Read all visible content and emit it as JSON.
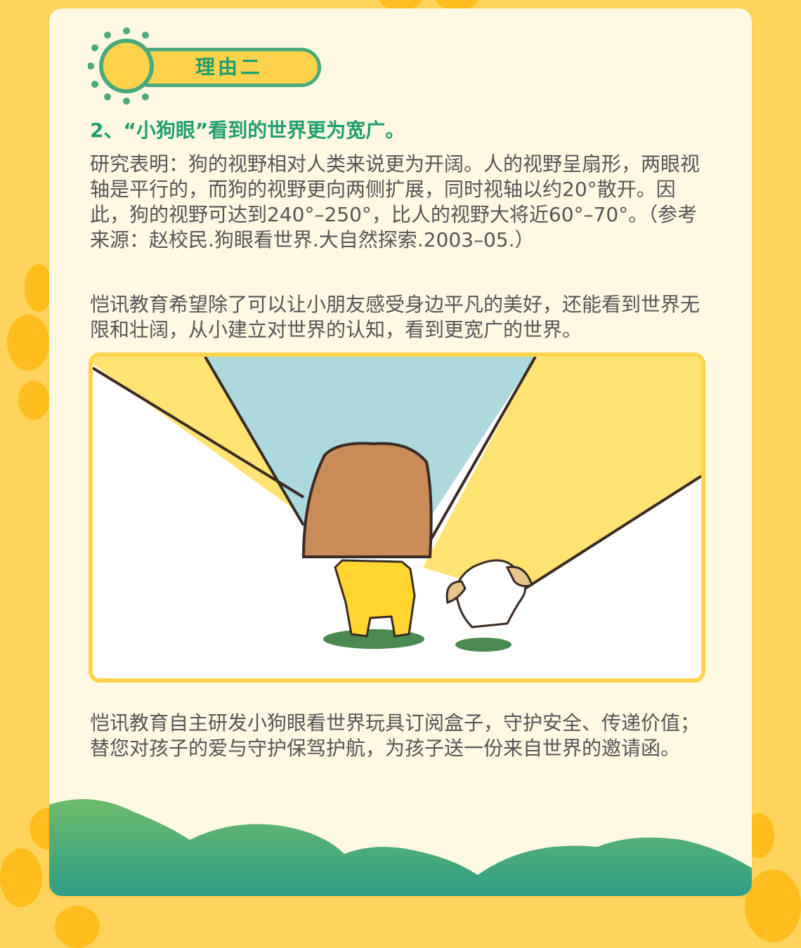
{
  "badge": {
    "label": "理由二"
  },
  "section": {
    "heading": "2、“小狗眼”看到的世界更为宽广。",
    "paragraph1": "研究表明：狗的视野相对人类来说更为开阔。人的视野呈扇形，两眼视轴是平行的，而狗的视野更向两侧扩展，同时视轴以约20°散开。因此，狗的视野可达到240°–250°，比人的视野大将近60°–70°。（参考来源：赵校民.狗眼看世界.大自然探索.2003–05.）",
    "paragraph2": "恺讯教育希望除了可以让小朋友感受身边平凡的美好，还能看到世界无限和壮阔，从小建立对世界的认知，看到更宽广的世界。",
    "paragraph3_line1": "恺讯教育自主研发小狗眼看世界玩具订阅盒子，守护安全、传递价值；",
    "paragraph3_line2": "替您对孩子的爱与守护保驾护航，为孩子送一份来自世界的邀请函。"
  },
  "colors": {
    "page_background": "#ffd45c",
    "card_background": "#fff9e3",
    "accent_green": "#1f9e6e",
    "accent_yellow": "#ffd24c",
    "paw": "#ffbe1e"
  },
  "icons": [
    "sun-icon",
    "paw-print-icon",
    "grass-hills"
  ]
}
